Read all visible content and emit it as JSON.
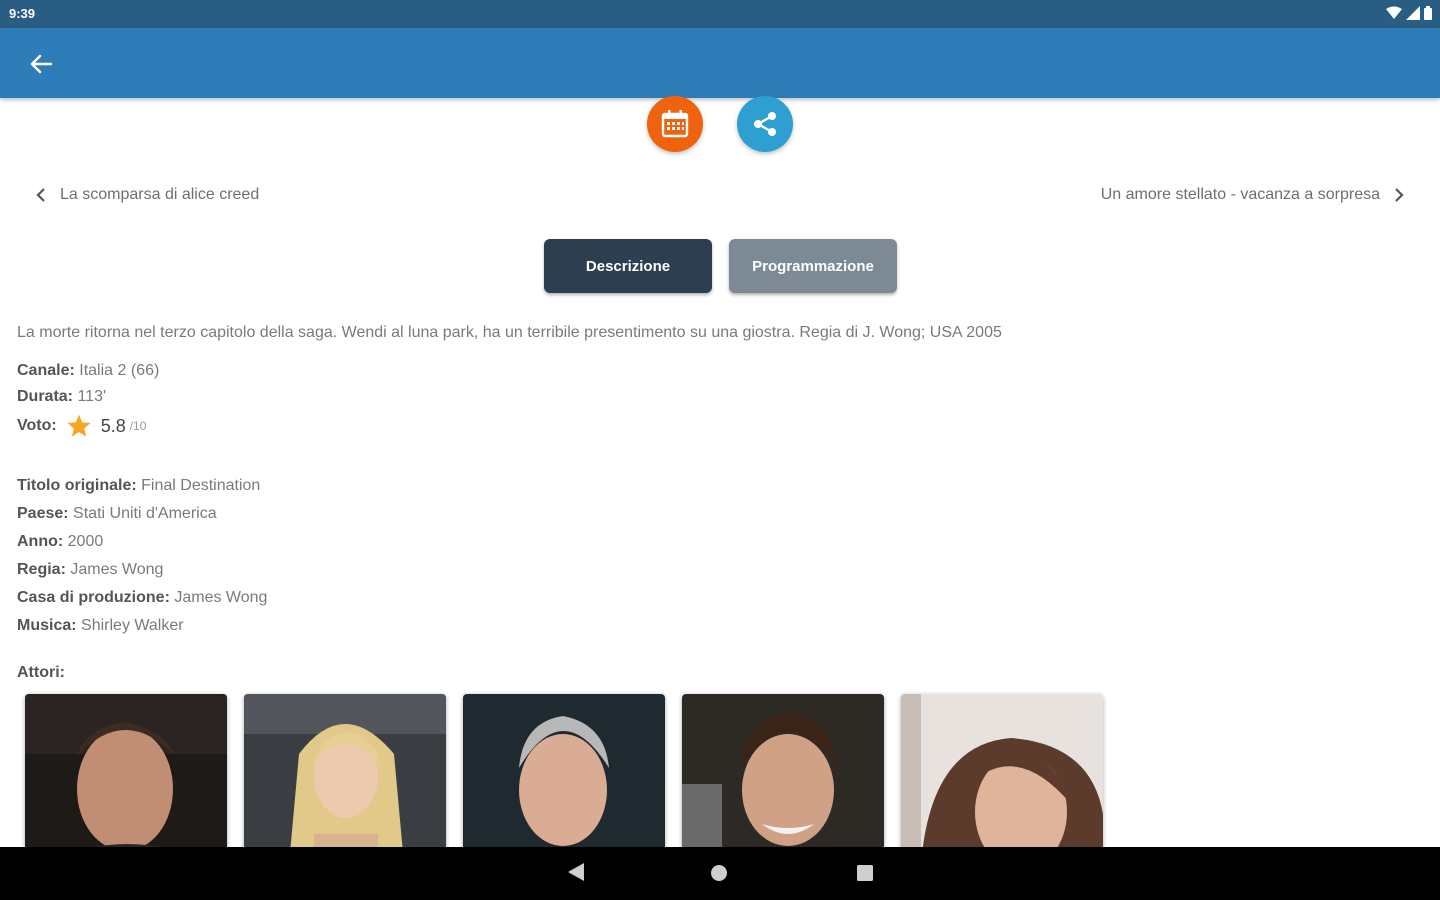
{
  "status_bar": {
    "time": "9:39"
  },
  "navigation": {
    "prev_title": "La scomparsa di alice creed",
    "next_title": "Un amore stellato - vacanza a sorpresa"
  },
  "tabs": [
    {
      "label": "Descrizione",
      "active": true
    },
    {
      "label": "Programmazione",
      "active": false
    }
  ],
  "description": "La morte ritorna nel terzo capitolo della saga. Wendi al luna park, ha un terribile presentimento su una giostra. Regia di J. Wong; USA 2005",
  "info": {
    "channel_label": "Canale:",
    "channel_value": "Italia 2 (66)",
    "duration_label": "Durata:",
    "duration_value": "113'",
    "rating_label": "Voto:",
    "rating_value": "5.8",
    "rating_max": "/10"
  },
  "details": [
    {
      "label": "Titolo originale:",
      "value": "Final Destination"
    },
    {
      "label": "Paese:",
      "value": "Stati Uniti d'America"
    },
    {
      "label": "Anno:",
      "value": "2000"
    },
    {
      "label": "Regia:",
      "value": "James Wong"
    },
    {
      "label": "Casa di produzione:",
      "value": "James Wong"
    },
    {
      "label": "Musica:",
      "value": "Shirley Walker"
    }
  ],
  "actors_label": "Attori:",
  "colors": {
    "status_bar": "#2a5d84",
    "app_bar": "#2f7db8",
    "fab_calendar": "#f0620d",
    "fab_share": "#2d9fd0",
    "tab_active": "#2d3e50",
    "tab_inactive": "#7d8a96",
    "star": "#f5a623"
  },
  "icons": [
    "back-arrow-icon",
    "calendar-icon",
    "share-icon",
    "chevron-left-icon",
    "chevron-right-icon",
    "star-icon",
    "wifi-icon",
    "signal-icon",
    "battery-icon",
    "nav-back-icon",
    "nav-home-icon",
    "nav-recents-icon"
  ]
}
